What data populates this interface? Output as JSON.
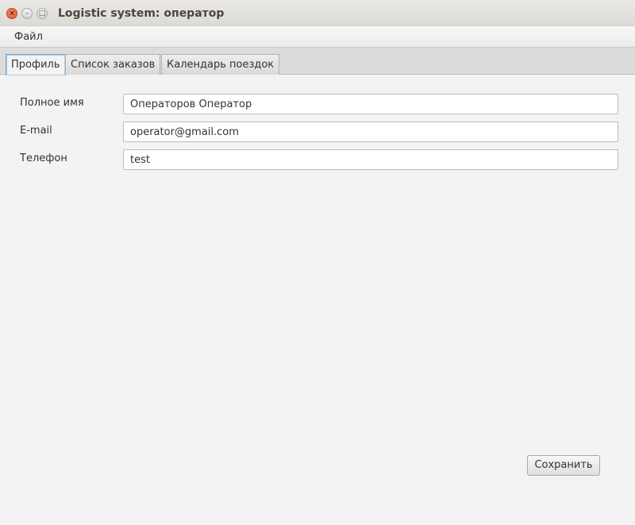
{
  "window": {
    "title": "Logistic system: оператор",
    "close_glyph": "×",
    "minimize_glyph": "–",
    "maximize_glyph": "□"
  },
  "menu": {
    "items": [
      {
        "label": "Файл"
      }
    ]
  },
  "tabs": [
    {
      "label": "Профиль",
      "active": true
    },
    {
      "label": "Список заказов",
      "active": false
    },
    {
      "label": "Календарь поездок",
      "active": false
    }
  ],
  "profile": {
    "full_name_label": "Полное имя",
    "full_name_value": "Операторов Оператор",
    "email_label": "E-mail",
    "email_value": "operator@gmail.com",
    "phone_label": "Телефон",
    "phone_value": "test",
    "save_label": "Сохранить"
  },
  "colors": {
    "active_tab_border": "#6fa6d6",
    "close_button": "#e0522d",
    "background": "#f3f3f3"
  }
}
